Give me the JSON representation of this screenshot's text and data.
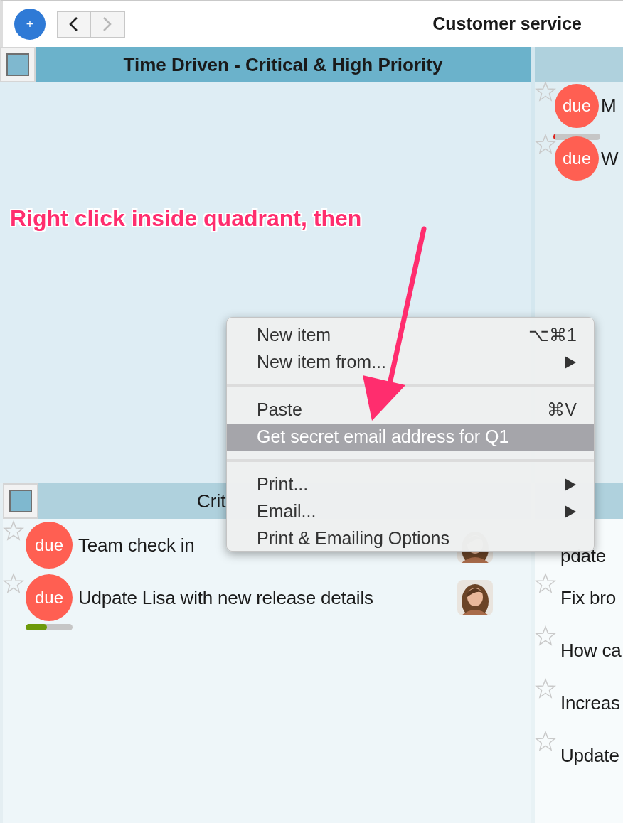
{
  "window": {
    "title": "Customer service"
  },
  "toolbar": {
    "add_label": "+",
    "back": {
      "disabled": false
    },
    "forward": {
      "disabled": true
    }
  },
  "quadrants": [
    {
      "title": "Time Driven - Critical & High Priority",
      "selected": true
    },
    {
      "selected": false,
      "items": [
        {
          "text": "M",
          "badge": "due",
          "starred": false,
          "level": 0.05
        },
        {
          "text": "W",
          "badge": "due",
          "starred": false
        }
      ]
    },
    {
      "title": "Crit",
      "selected": false,
      "items": [
        {
          "text": "Team check in",
          "badge": "due",
          "starred": false,
          "avatar": true
        },
        {
          "text": "Udpate Lisa with new release details",
          "badge": "due",
          "starred": false,
          "level": 0.45,
          "avatar": true
        }
      ]
    },
    {
      "selected": false,
      "items": [
        {
          "text": "pdate"
        },
        {
          "text": "Fix bro",
          "starred": false
        },
        {
          "text": "How ca",
          "starred": false
        },
        {
          "text": "Increas",
          "starred": false
        },
        {
          "text": "Update",
          "starred": false
        }
      ]
    }
  ],
  "annotation": {
    "text": "Right click inside quadrant, then"
  },
  "context_menu": {
    "items": [
      {
        "kind": "item",
        "label": "New item",
        "shortcut": "⌥⌘1",
        "submenu": false,
        "selected": false
      },
      {
        "kind": "item",
        "label": "New item from...",
        "submenu": true,
        "selected": false
      },
      {
        "kind": "separator"
      },
      {
        "kind": "item",
        "label": "Paste",
        "shortcut": "⌘V",
        "submenu": false,
        "selected": false
      },
      {
        "kind": "item",
        "label": "Get secret email address for Q1",
        "submenu": false,
        "selected": true
      },
      {
        "kind": "separator"
      },
      {
        "kind": "item",
        "label": "Print...",
        "submenu": true,
        "selected": false
      },
      {
        "kind": "item",
        "label": "Email...",
        "submenu": true,
        "selected": false
      },
      {
        "kind": "item",
        "label": "Print & Emailing Options",
        "submenu": false,
        "selected": false
      }
    ]
  }
}
